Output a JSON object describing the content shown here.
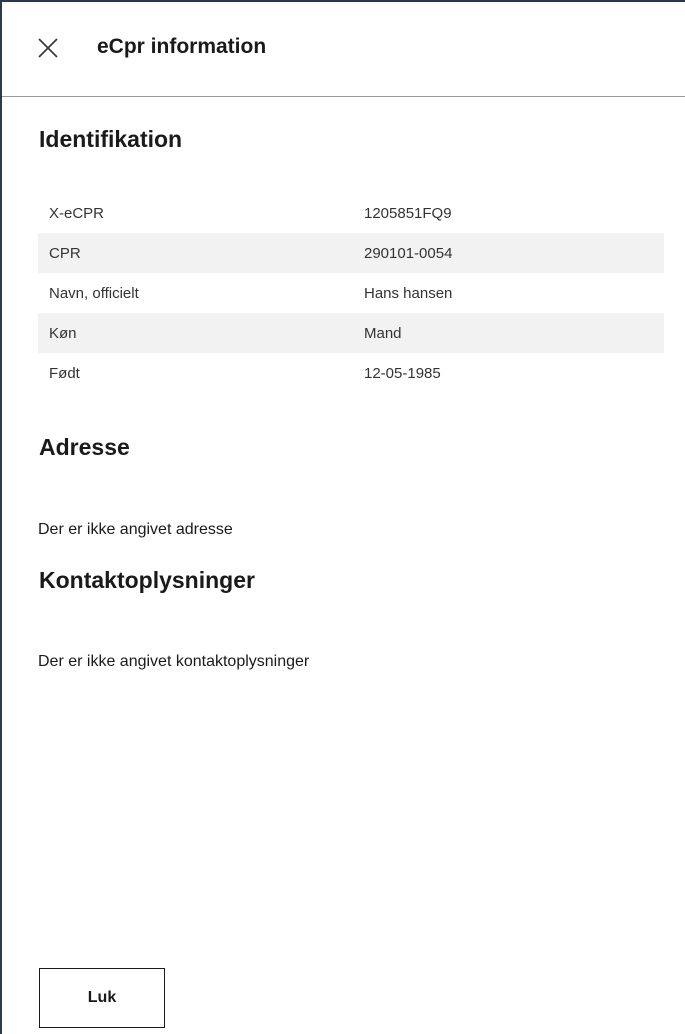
{
  "header": {
    "title": "eCpr information",
    "close_icon": "close-icon"
  },
  "identifikation": {
    "heading": "Identifikation",
    "rows": [
      {
        "label": "X-eCPR",
        "value": "1205851FQ9"
      },
      {
        "label": "CPR",
        "value": "290101-0054"
      },
      {
        "label": "Navn, officielt",
        "value": "Hans hansen"
      },
      {
        "label": "Køn",
        "value": "Mand"
      },
      {
        "label": "Født",
        "value": "12-05-1985"
      }
    ]
  },
  "adresse": {
    "heading": "Adresse",
    "empty_text": "Der er ikke angivet adresse"
  },
  "kontakt": {
    "heading": "Kontaktoplysninger",
    "empty_text": "Der er ikke angivet kontaktoplysninger"
  },
  "footer": {
    "close_label": "Luk"
  }
}
